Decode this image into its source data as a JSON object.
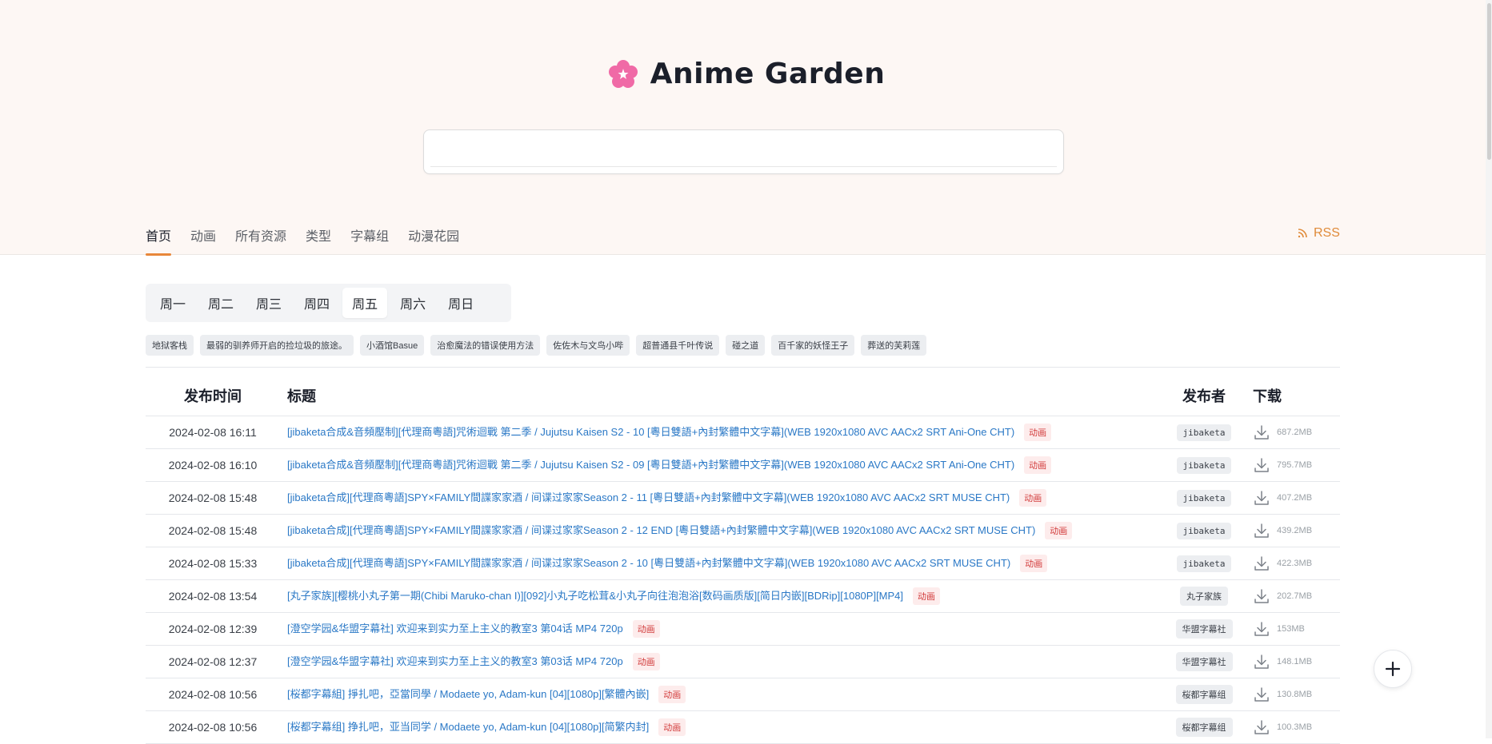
{
  "brand": {
    "title": "Anime Garden",
    "logo_icon": "sakura-flower-icon"
  },
  "search": {
    "value": ""
  },
  "nav": {
    "items": [
      {
        "label": "首页",
        "active": true
      },
      {
        "label": "动画"
      },
      {
        "label": "所有资源"
      },
      {
        "label": "类型"
      },
      {
        "label": "字幕组"
      },
      {
        "label": "动漫花园"
      }
    ],
    "rss_label": "RSS"
  },
  "weekdays": [
    "周一",
    "周二",
    "周三",
    "周四",
    "周五",
    "周六",
    "周日"
  ],
  "weekday_active": "周五",
  "tags": [
    "地狱客栈",
    "最弱的驯养师开启的捡垃圾的旅途。",
    "小酒馆Basue",
    "治愈魔法的错误使用方法",
    "佐佐木与文鸟小哔",
    "超普通县千叶传说",
    "碰之道",
    "百千家的妖怪王子",
    "葬送的芙莉莲"
  ],
  "table": {
    "headers": {
      "time": "发布时间",
      "title": "标题",
      "publisher": "发布者",
      "download": "下载"
    },
    "rows": [
      {
        "time": "2024-02-08 16:11",
        "title": "[jibaketa合成&音頻壓制][代理商粵語]咒術迴戰 第二季 / Jujutsu Kaisen S2 - 10 [粵日雙語+內封繁體中文字幕](WEB 1920x1080 AVC AACx2 SRT Ani-One CHT)",
        "type": "动画",
        "publisher": "jibaketa",
        "size": "687.2MB"
      },
      {
        "time": "2024-02-08 16:10",
        "title": "[jibaketa合成&音頻壓制][代理商粵語]咒術迴戰 第二季 / Jujutsu Kaisen S2 - 09 [粵日雙語+內封繁體中文字幕](WEB 1920x1080 AVC AACx2 SRT Ani-One CHT)",
        "type": "动画",
        "publisher": "jibaketa",
        "size": "795.7MB"
      },
      {
        "time": "2024-02-08 15:48",
        "title": "[jibaketa合成][代理商粵語]SPY×FAMILY間諜家家酒 / 间谍过家家Season 2 - 11 [粵日雙語+內封繁體中文字幕](WEB 1920x1080 AVC AACx2 SRT MUSE CHT)",
        "type": "动画",
        "publisher": "jibaketa",
        "size": "407.2MB"
      },
      {
        "time": "2024-02-08 15:48",
        "title": "[jibaketa合成][代理商粵語]SPY×FAMILY間諜家家酒 / 间谍过家家Season 2 - 12 END [粵日雙語+內封繁體中文字幕](WEB 1920x1080 AVC AACx2 SRT MUSE CHT)",
        "type": "动画",
        "publisher": "jibaketa",
        "size": "439.2MB"
      },
      {
        "time": "2024-02-08 15:33",
        "title": "[jibaketa合成][代理商粵語]SPY×FAMILY間諜家家酒 / 间谍过家家Season 2 - 10 [粵日雙語+內封繁體中文字幕](WEB 1920x1080 AVC AACx2 SRT MUSE CHT)",
        "type": "动画",
        "publisher": "jibaketa",
        "size": "422.3MB"
      },
      {
        "time": "2024-02-08 13:54",
        "title": "[丸子家族][樱桃小丸子第一期(Chibi Maruko-chan I)][092]小丸子吃松茸&小丸子向往泡泡浴[数码画质版][简日内嵌][BDRip][1080P][MP4]",
        "type": "动画",
        "publisher": "丸子家族",
        "size": "202.7MB"
      },
      {
        "time": "2024-02-08 12:39",
        "title": "[澄空学园&华盟字幕社] 欢迎来到实力至上主义的教室3 第04话 MP4 720p",
        "type": "动画",
        "publisher": "华盟字幕社",
        "size": "153MB"
      },
      {
        "time": "2024-02-08 12:37",
        "title": "[澄空学园&华盟字幕社] 欢迎来到实力至上主义的教室3 第03话 MP4 720p",
        "type": "动画",
        "publisher": "华盟字幕社",
        "size": "148.1MB"
      },
      {
        "time": "2024-02-08 10:56",
        "title": "[桜都字幕組] 掙扎吧，亞當同學 / Modaete yo, Adam-kun [04][1080p][繁體內嵌]",
        "type": "动画",
        "publisher": "桜都字幕组",
        "size": "130.8MB"
      },
      {
        "time": "2024-02-08 10:56",
        "title": "[桜都字幕组] 挣扎吧，亚当同学 / Modaete yo, Adam-kun [04][1080p][简繁内封]",
        "type": "动画",
        "publisher": "桜都字幕组",
        "size": "100.3MB"
      }
    ]
  },
  "fab_icon": "plus-icon",
  "colors": {
    "accent": "#e8873a",
    "link": "#2a78c6",
    "type_badge": "#d23b3b",
    "hero_bg": "#fdf7f4"
  }
}
